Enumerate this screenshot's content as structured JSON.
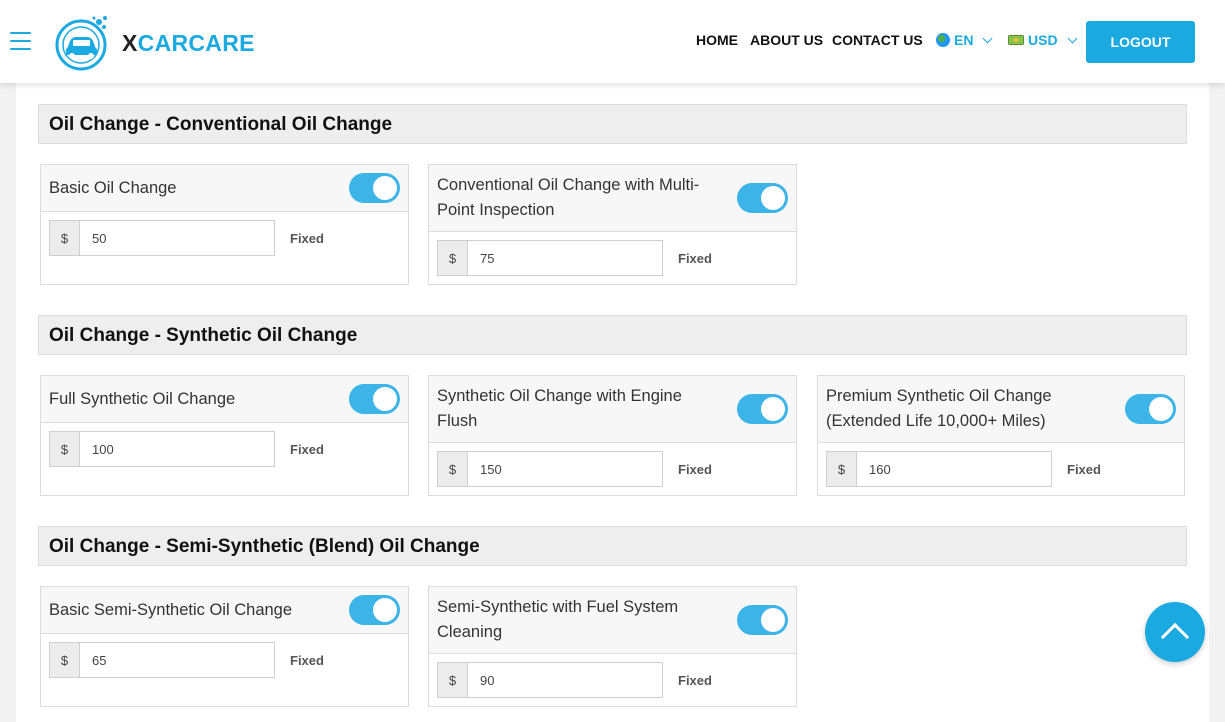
{
  "brand": {
    "prefix": "X",
    "name": "CARCARE"
  },
  "nav": {
    "home": "HOME",
    "about": "ABOUT US",
    "contact": "CONTACT US"
  },
  "language": {
    "code": "EN",
    "icon": "globe-icon"
  },
  "currency": {
    "code": "USD",
    "icon": "money-icon"
  },
  "logout_label": "LOGOUT",
  "colors": {
    "accent": "#1ba9e1",
    "toggle_on": "#3db4e8",
    "section_bg": "#eeeeee"
  },
  "sections": [
    {
      "title": "Oil Change - Conventional Oil Change",
      "services": [
        {
          "name": "Basic Oil Change",
          "currency": "$",
          "price": "50",
          "type": "Fixed",
          "enabled": true
        },
        {
          "name": "Conventional Oil Change with Multi-Point Inspection",
          "currency": "$",
          "price": "75",
          "type": "Fixed",
          "enabled": true
        }
      ]
    },
    {
      "title": "Oil Change - Synthetic Oil Change",
      "services": [
        {
          "name": "Full Synthetic Oil Change",
          "currency": "$",
          "price": "100",
          "type": "Fixed",
          "enabled": true
        },
        {
          "name": "Synthetic Oil Change with Engine Flush",
          "currency": "$",
          "price": "150",
          "type": "Fixed",
          "enabled": true
        },
        {
          "name": "Premium Synthetic Oil Change (Extended Life 10,000+ Miles)",
          "currency": "$",
          "price": "160",
          "type": "Fixed",
          "enabled": true
        }
      ]
    },
    {
      "title": "Oil Change - Semi-Synthetic (Blend) Oil Change",
      "services": [
        {
          "name": "Basic Semi-Synthetic Oil Change",
          "currency": "$",
          "price": "65",
          "type": "Fixed",
          "enabled": true
        },
        {
          "name": "Semi-Synthetic with Fuel System Cleaning",
          "currency": "$",
          "price": "90",
          "type": "Fixed",
          "enabled": true
        }
      ]
    }
  ]
}
